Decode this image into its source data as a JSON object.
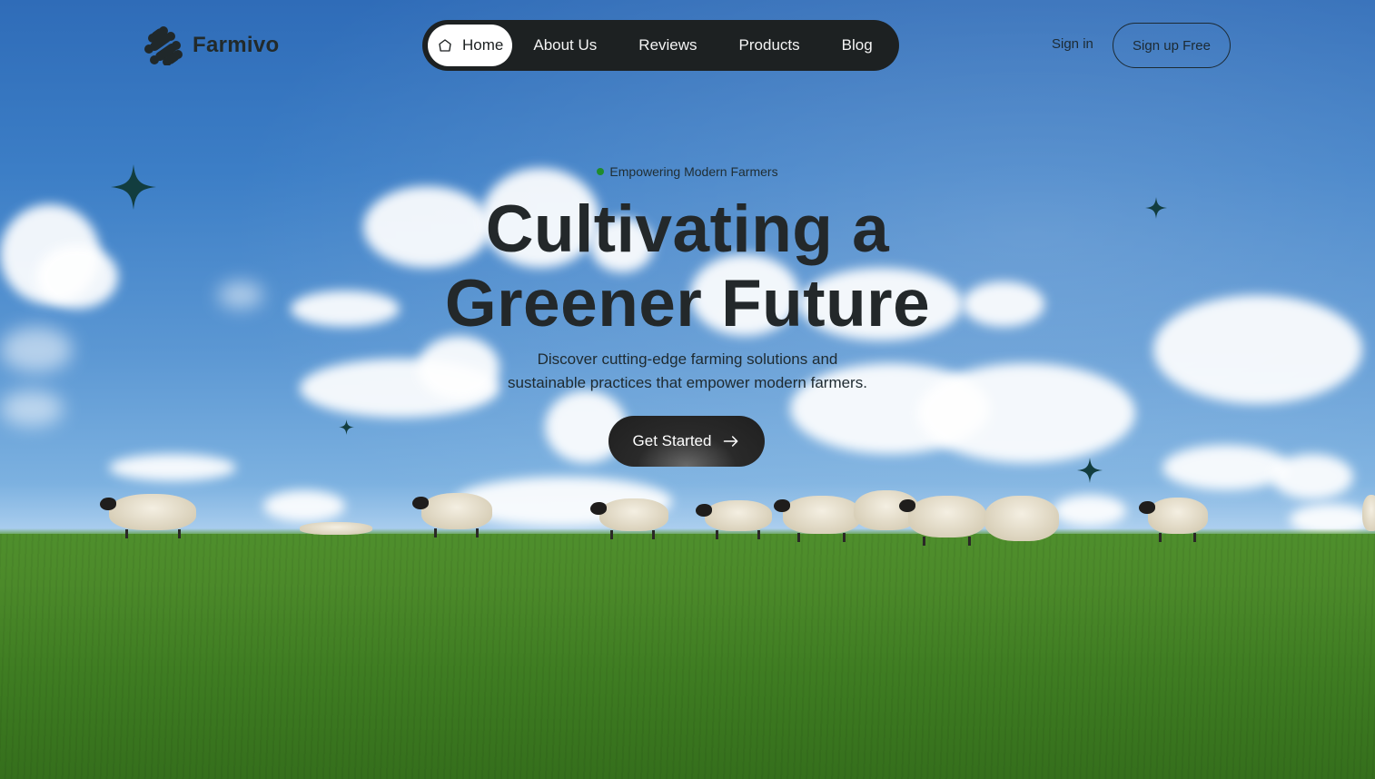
{
  "brand": {
    "name": "Farmivo"
  },
  "nav": {
    "items": [
      {
        "label": "Home",
        "active": true,
        "icon": "home-icon"
      },
      {
        "label": "About Us"
      },
      {
        "label": "Reviews"
      },
      {
        "label": "Products"
      },
      {
        "label": "Blog"
      }
    ]
  },
  "auth": {
    "signin_label": "Sign in",
    "signup_label": "Sign up Free"
  },
  "hero": {
    "tagline": "Empowering Modern Farmers",
    "headline_line1": "Cultivating a",
    "headline_line2": "Greener Future",
    "sub_line1": "Discover cutting-edge farming solutions and",
    "sub_line2": "sustainable practices that empower modern farmers.",
    "cta_label": "Get Started",
    "cta_icon": "arrow-right-icon"
  },
  "colors": {
    "accent_dark": "#1d2122",
    "tagline_dot": "#1f8c2d",
    "sparkle": "#123d3f"
  }
}
